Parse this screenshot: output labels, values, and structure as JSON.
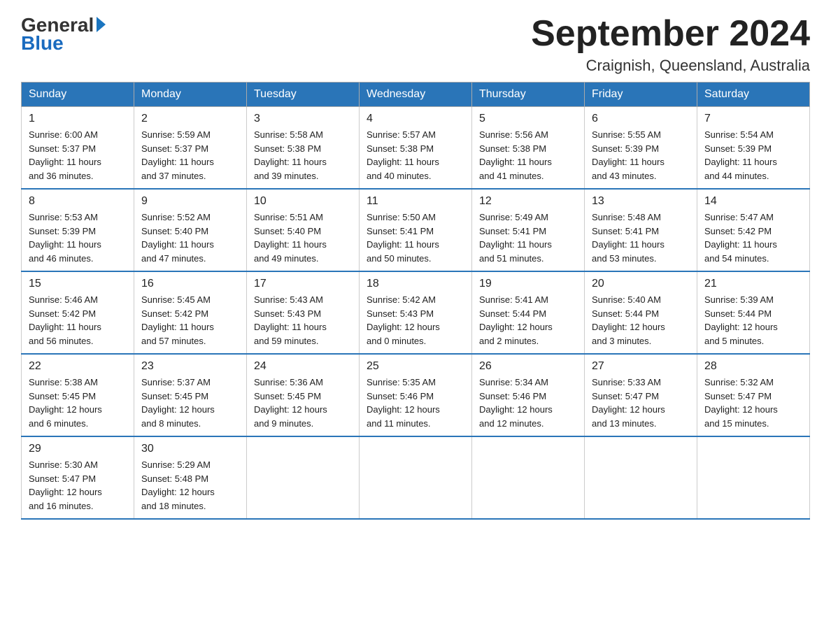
{
  "header": {
    "logo_general": "General",
    "logo_blue": "Blue",
    "month_title": "September 2024",
    "location": "Craignish, Queensland, Australia"
  },
  "days_of_week": [
    "Sunday",
    "Monday",
    "Tuesday",
    "Wednesday",
    "Thursday",
    "Friday",
    "Saturday"
  ],
  "weeks": [
    [
      {
        "day": "1",
        "sunrise": "6:00 AM",
        "sunset": "5:37 PM",
        "daylight": "11 hours and 36 minutes."
      },
      {
        "day": "2",
        "sunrise": "5:59 AM",
        "sunset": "5:37 PM",
        "daylight": "11 hours and 37 minutes."
      },
      {
        "day": "3",
        "sunrise": "5:58 AM",
        "sunset": "5:38 PM",
        "daylight": "11 hours and 39 minutes."
      },
      {
        "day": "4",
        "sunrise": "5:57 AM",
        "sunset": "5:38 PM",
        "daylight": "11 hours and 40 minutes."
      },
      {
        "day": "5",
        "sunrise": "5:56 AM",
        "sunset": "5:38 PM",
        "daylight": "11 hours and 41 minutes."
      },
      {
        "day": "6",
        "sunrise": "5:55 AM",
        "sunset": "5:39 PM",
        "daylight": "11 hours and 43 minutes."
      },
      {
        "day": "7",
        "sunrise": "5:54 AM",
        "sunset": "5:39 PM",
        "daylight": "11 hours and 44 minutes."
      }
    ],
    [
      {
        "day": "8",
        "sunrise": "5:53 AM",
        "sunset": "5:39 PM",
        "daylight": "11 hours and 46 minutes."
      },
      {
        "day": "9",
        "sunrise": "5:52 AM",
        "sunset": "5:40 PM",
        "daylight": "11 hours and 47 minutes."
      },
      {
        "day": "10",
        "sunrise": "5:51 AM",
        "sunset": "5:40 PM",
        "daylight": "11 hours and 49 minutes."
      },
      {
        "day": "11",
        "sunrise": "5:50 AM",
        "sunset": "5:41 PM",
        "daylight": "11 hours and 50 minutes."
      },
      {
        "day": "12",
        "sunrise": "5:49 AM",
        "sunset": "5:41 PM",
        "daylight": "11 hours and 51 minutes."
      },
      {
        "day": "13",
        "sunrise": "5:48 AM",
        "sunset": "5:41 PM",
        "daylight": "11 hours and 53 minutes."
      },
      {
        "day": "14",
        "sunrise": "5:47 AM",
        "sunset": "5:42 PM",
        "daylight": "11 hours and 54 minutes."
      }
    ],
    [
      {
        "day": "15",
        "sunrise": "5:46 AM",
        "sunset": "5:42 PM",
        "daylight": "11 hours and 56 minutes."
      },
      {
        "day": "16",
        "sunrise": "5:45 AM",
        "sunset": "5:42 PM",
        "daylight": "11 hours and 57 minutes."
      },
      {
        "day": "17",
        "sunrise": "5:43 AM",
        "sunset": "5:43 PM",
        "daylight": "11 hours and 59 minutes."
      },
      {
        "day": "18",
        "sunrise": "5:42 AM",
        "sunset": "5:43 PM",
        "daylight": "12 hours and 0 minutes."
      },
      {
        "day": "19",
        "sunrise": "5:41 AM",
        "sunset": "5:44 PM",
        "daylight": "12 hours and 2 minutes."
      },
      {
        "day": "20",
        "sunrise": "5:40 AM",
        "sunset": "5:44 PM",
        "daylight": "12 hours and 3 minutes."
      },
      {
        "day": "21",
        "sunrise": "5:39 AM",
        "sunset": "5:44 PM",
        "daylight": "12 hours and 5 minutes."
      }
    ],
    [
      {
        "day": "22",
        "sunrise": "5:38 AM",
        "sunset": "5:45 PM",
        "daylight": "12 hours and 6 minutes."
      },
      {
        "day": "23",
        "sunrise": "5:37 AM",
        "sunset": "5:45 PM",
        "daylight": "12 hours and 8 minutes."
      },
      {
        "day": "24",
        "sunrise": "5:36 AM",
        "sunset": "5:45 PM",
        "daylight": "12 hours and 9 minutes."
      },
      {
        "day": "25",
        "sunrise": "5:35 AM",
        "sunset": "5:46 PM",
        "daylight": "12 hours and 11 minutes."
      },
      {
        "day": "26",
        "sunrise": "5:34 AM",
        "sunset": "5:46 PM",
        "daylight": "12 hours and 12 minutes."
      },
      {
        "day": "27",
        "sunrise": "5:33 AM",
        "sunset": "5:47 PM",
        "daylight": "12 hours and 13 minutes."
      },
      {
        "day": "28",
        "sunrise": "5:32 AM",
        "sunset": "5:47 PM",
        "daylight": "12 hours and 15 minutes."
      }
    ],
    [
      {
        "day": "29",
        "sunrise": "5:30 AM",
        "sunset": "5:47 PM",
        "daylight": "12 hours and 16 minutes."
      },
      {
        "day": "30",
        "sunrise": "5:29 AM",
        "sunset": "5:48 PM",
        "daylight": "12 hours and 18 minutes."
      },
      null,
      null,
      null,
      null,
      null
    ]
  ],
  "labels": {
    "sunrise_prefix": "Sunrise: ",
    "sunset_prefix": "Sunset: ",
    "daylight_prefix": "Daylight: "
  }
}
